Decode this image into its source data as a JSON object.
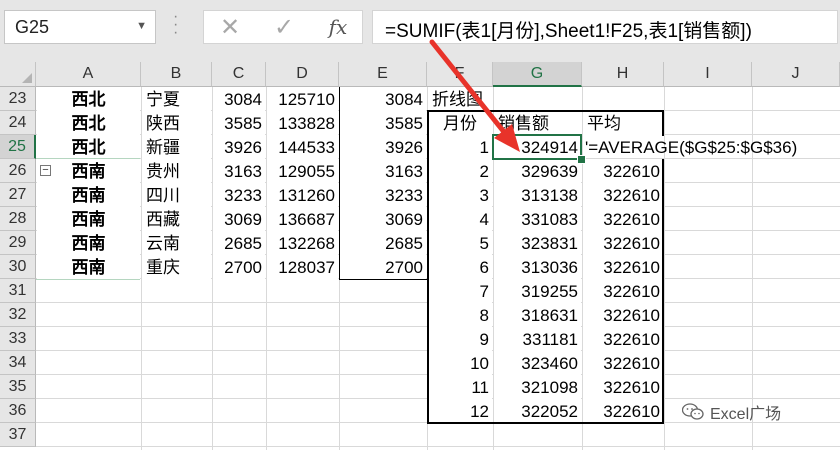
{
  "formula_bar": {
    "name_box": "G25",
    "cancel_icon": "✕",
    "enter_icon": "✓",
    "fx_label": "fx",
    "formula": "=SUMIF(表1[月份],Sheet1!F25,表1[销售额])"
  },
  "columns": [
    "A",
    "B",
    "C",
    "D",
    "E",
    "F",
    "G",
    "H",
    "I",
    "J"
  ],
  "selected_column": "G",
  "rows": [
    "23",
    "24",
    "25",
    "26",
    "27",
    "28",
    "29",
    "30",
    "31",
    "32",
    "33",
    "34",
    "35",
    "36",
    "37"
  ],
  "selected_row": "25",
  "left_table": [
    {
      "region": "西北",
      "province": "宁夏",
      "c": "3084",
      "d": "125710",
      "e": "3084"
    },
    {
      "region": "西北",
      "province": "陕西",
      "c": "3585",
      "d": "133828",
      "e": "3585"
    },
    {
      "region": "西北",
      "province": "新疆",
      "c": "3926",
      "d": "144533",
      "e": "3926"
    },
    {
      "region": "西南",
      "province": "贵州",
      "c": "3163",
      "d": "129055",
      "e": "3163"
    },
    {
      "region": "西南",
      "province": "四川",
      "c": "3233",
      "d": "131260",
      "e": "3233"
    },
    {
      "region": "西南",
      "province": "西藏",
      "c": "3069",
      "d": "136687",
      "e": "3069"
    },
    {
      "region": "西南",
      "province": "云南",
      "c": "2685",
      "d": "132268",
      "e": "2685"
    },
    {
      "region": "西南",
      "province": "重庆",
      "c": "2700",
      "d": "128037",
      "e": "2700"
    }
  ],
  "right_table": {
    "title": "折线图",
    "headers": [
      "月份",
      "销售额",
      "平均"
    ],
    "formula_display": "'=AVERAGE($G$25:$G$36)",
    "rows": [
      {
        "month": "1",
        "sales": "324914",
        "avg": ""
      },
      {
        "month": "2",
        "sales": "329639",
        "avg": "322610"
      },
      {
        "month": "3",
        "sales": "313138",
        "avg": "322610"
      },
      {
        "month": "4",
        "sales": "331083",
        "avg": "322610"
      },
      {
        "month": "5",
        "sales": "323831",
        "avg": "322610"
      },
      {
        "month": "6",
        "sales": "313036",
        "avg": "322610"
      },
      {
        "month": "7",
        "sales": "319255",
        "avg": "322610"
      },
      {
        "month": "8",
        "sales": "318631",
        "avg": "322610"
      },
      {
        "month": "9",
        "sales": "331181",
        "avg": "322610"
      },
      {
        "month": "10",
        "sales": "323460",
        "avg": "322610"
      },
      {
        "month": "11",
        "sales": "321098",
        "avg": "322610"
      },
      {
        "month": "12",
        "sales": "322052",
        "avg": "322610"
      }
    ]
  },
  "watermark": "Excel广场",
  "colors": {
    "accent": "#217346",
    "arrow": "#e8332a"
  }
}
